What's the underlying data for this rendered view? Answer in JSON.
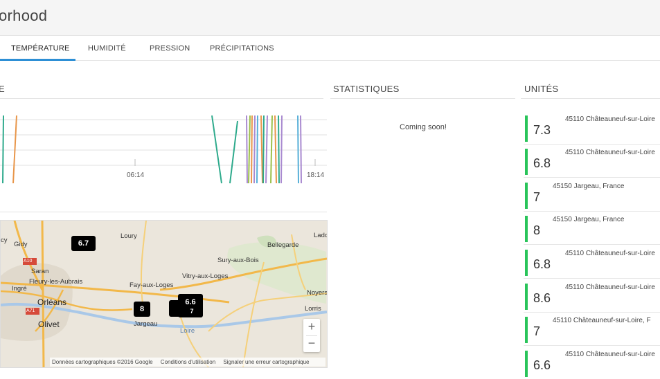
{
  "app": {
    "title": "orhood"
  },
  "tabs": [
    {
      "label": "TEMPÉRATURE",
      "active": true
    },
    {
      "label": "HUMIDITÉ",
      "active": false
    },
    {
      "label": "PRESSION",
      "active": false
    },
    {
      "label": "PRÉCIPITATIONS",
      "active": false
    }
  ],
  "sections": {
    "chart_title": "E",
    "stats_title": "STATISTIQUES",
    "units_title": "UNITÉS"
  },
  "stats": {
    "message": "Coming soon!"
  },
  "chart_data": {
    "type": "line",
    "x_ticks": [
      "06:14",
      "18:14"
    ],
    "grid": true,
    "series_colors": [
      "#2eaa8c",
      "#e8964a",
      "#a98ad0",
      "#9bc04a",
      "#58b0d8"
    ]
  },
  "map": {
    "places": [
      "Loury",
      "Bellegarde",
      "Gidy",
      "Saran",
      "Fleury-les-Aubrais",
      "Ingré",
      "Orléans",
      "Olivet",
      "Sury-aux-Bois",
      "Vitry-aux-Loges",
      "Fay-aux-Loges",
      "Jargeau",
      "Noyers",
      "Lorris",
      "Loire",
      "Ladc",
      "cy"
    ],
    "roads": [
      "A10",
      "A71"
    ],
    "markers": [
      "6.7",
      "8",
      "6.6",
      "7"
    ],
    "zoom_in": "+",
    "zoom_out": "−",
    "footer": {
      "data": "Données cartographiques ©2016 Google",
      "terms": "Conditions d'utilisation",
      "report": "Signaler une erreur cartographique"
    }
  },
  "units": [
    {
      "value": "7.3",
      "address": "45110 Châteauneuf-sur-Loire"
    },
    {
      "value": "6.8",
      "address": "45110 Châteauneuf-sur-Loire"
    },
    {
      "value": "7",
      "address": "45150 Jargeau, France"
    },
    {
      "value": "8",
      "address": "45150 Jargeau, France"
    },
    {
      "value": "6.8",
      "address": "45110 Châteauneuf-sur-Loire"
    },
    {
      "value": "8.6",
      "address": "45110 Châteauneuf-sur-Loire"
    },
    {
      "value": "7",
      "address": "45110 Châteauneuf-sur-Loire, F"
    },
    {
      "value": "6.6",
      "address": "45110 Châteauneuf-sur-Loire"
    }
  ]
}
